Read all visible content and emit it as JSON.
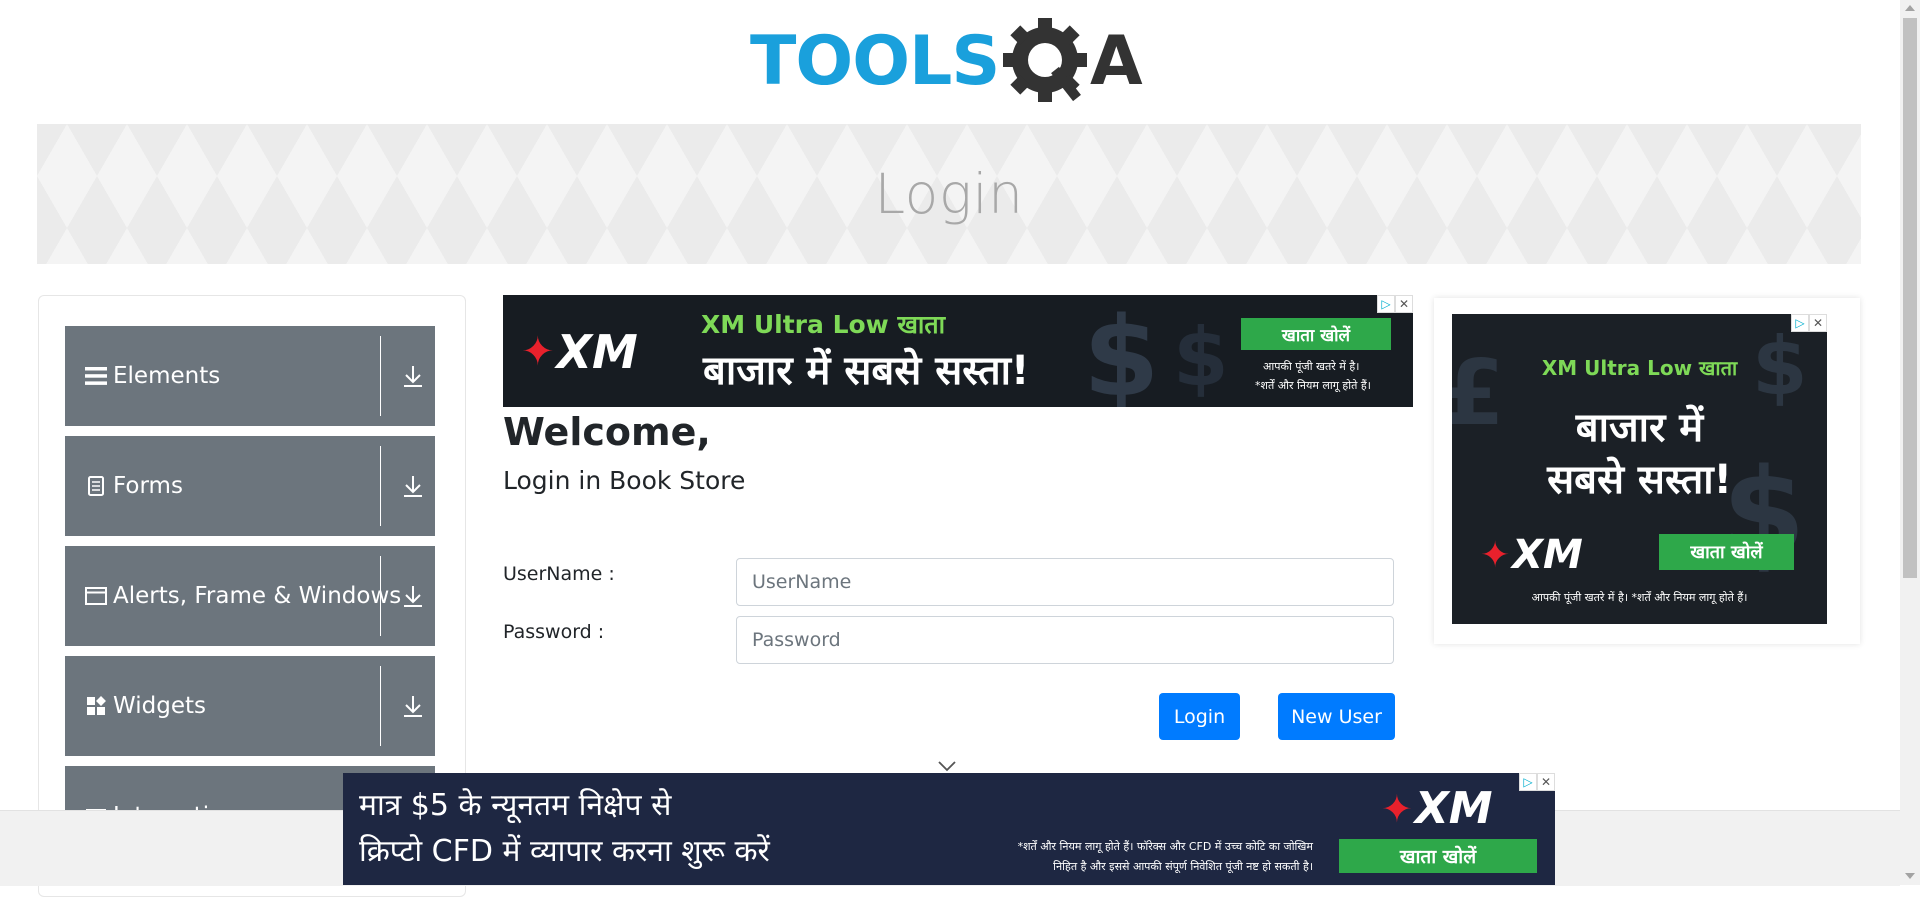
{
  "header": {
    "logo_text_left": "TOOLS",
    "logo_text_right": "A"
  },
  "banner": {
    "title": "Login"
  },
  "sidebar": {
    "groups": [
      {
        "label": "Elements",
        "icon": "hamburger-icon"
      },
      {
        "label": "Forms",
        "icon": "document-icon"
      },
      {
        "label": "Alerts, Frame & Windows",
        "icon": "window-icon"
      },
      {
        "label": "Widgets",
        "icon": "widgets-icon"
      },
      {
        "label": "Interactions",
        "icon": "interactions-icon"
      }
    ]
  },
  "main": {
    "welcome": "Welcome,",
    "subtitle": "Login in Book Store",
    "username_label": "UserName :",
    "username_placeholder": "UserName",
    "password_label": "Password :",
    "password_placeholder": "Password",
    "login_button": "Login",
    "new_user_button": "New User"
  },
  "ads": {
    "top": {
      "brand": "XM",
      "headline": "XM Ultra Low खाता",
      "tagline": "बाजार में सबसे सस्ता!",
      "cta": "खाता खोलें",
      "disclaimer_1": "आपकी पूंजी खतरे में है।",
      "disclaimer_2": "*शर्तें और नियम लागू होते हैं।"
    },
    "right": {
      "headline": "XM Ultra Low खाता",
      "tagline_1": "बाजार में",
      "tagline_2": "सबसे सस्ता!",
      "brand": "XM",
      "cta": "खाता खोलें",
      "disclaimer": "आपकी पूंजी खतरे में है। *शर्तें और नियम लागू होते हैं।"
    },
    "bottom": {
      "line_1": "मात्र $5 के न्यूनतम निक्षेप से",
      "line_2": "क्रिप्टो CFD में व्यापार करना शुरू करें",
      "brand": "XM",
      "disclaimer_1": "*शर्तें और नियम लागू होते हैं। फॉरेक्स और CFD में उच्च कोटि का जोखिम",
      "disclaimer_2": "निहित है और इससे आपकी संपूर्ण निवेशित पूंजी नष्ट हो सकती है।",
      "cta": "खाता खोलें"
    }
  },
  "colors": {
    "logo_blue": "#1aa0dc",
    "logo_gray": "#333333",
    "sidebar_header": "#6c757d",
    "primary": "#007bff",
    "ad_green": "#2ea84a"
  }
}
